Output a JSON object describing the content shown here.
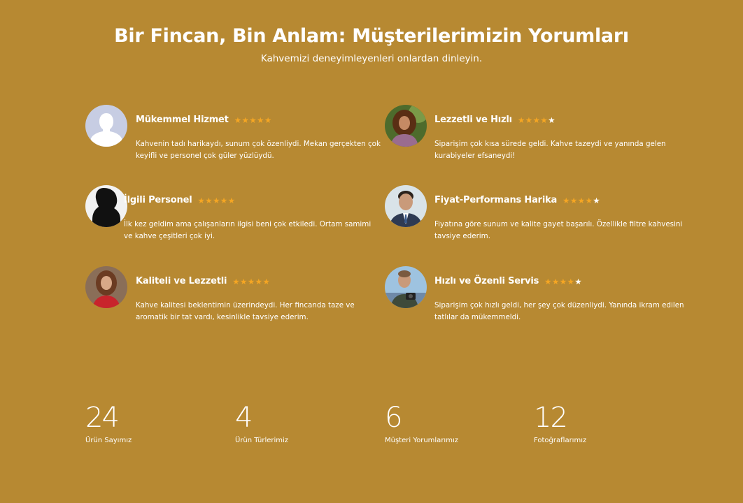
{
  "header": {
    "title": "Bir Fincan, Bin Anlam: Müşterilerimizin Yorumları",
    "subtitle": "Kahvemizi deneyimleyenleri onlardan dinleyin."
  },
  "reviews": [
    {
      "title": "Mükemmel Hizmet",
      "rating": 5,
      "text": "Kahvenin tadı harikaydı, sunum çok özenliydi. Mekan gerçekten çok keyifli ve personel çok güler yüzlüydü.",
      "avatar": "default-avatar-icon"
    },
    {
      "title": "Lezzetli ve Hızlı",
      "rating": 4,
      "text": "Siparişim çok kısa sürede geldi. Kahve tazeydi ve yanında gelen kurabiyeler efsaneydi!",
      "avatar": "woman-curly-hair-photo"
    },
    {
      "title": "İlgili Personel",
      "rating": 5,
      "text": "İlk kez geldim ama çalışanların ilgisi beni çok etkiledi. Ortam samimi ve kahve çeşitleri çok iyi.",
      "avatar": "silhouette-photo"
    },
    {
      "title": "Fiyat-Performans Harika",
      "rating": 4,
      "text": "Fiyatına göre sunum ve kalite gayet başarılı. Özellikle filtre kahvesini tavsiye ederim.",
      "avatar": "man-suit-photo"
    },
    {
      "title": "Kaliteli ve Lezzetli",
      "rating": 5,
      "text": "Kahve kalitesi beklentimin üzerindeydi. Her fincanda taze ve aromatik bir tat vardı, kesinlikle tavsiye ederim.",
      "avatar": "woman-red-scarf-photo"
    },
    {
      "title": "Hızlı ve Özenli Servis",
      "rating": 4,
      "text": "Siparişim çok hızlı geldi, her şey çok düzenliydi. Yanında ikram edilen tatlılar da mükemmeldi.",
      "avatar": "man-camera-photo"
    }
  ],
  "stats": [
    {
      "value": "24",
      "label": "Ürün Sayımız"
    },
    {
      "value": "4",
      "label": "Ürün Türlerimiz"
    },
    {
      "value": "6",
      "label": "Müşteri Yorumlarımız"
    },
    {
      "value": "12",
      "label": "Fotoğraflarımız"
    }
  ],
  "colors": {
    "background": "#b78932",
    "star_on": "#f5a623",
    "star_off": "#ffffff",
    "text": "#ffffff"
  }
}
